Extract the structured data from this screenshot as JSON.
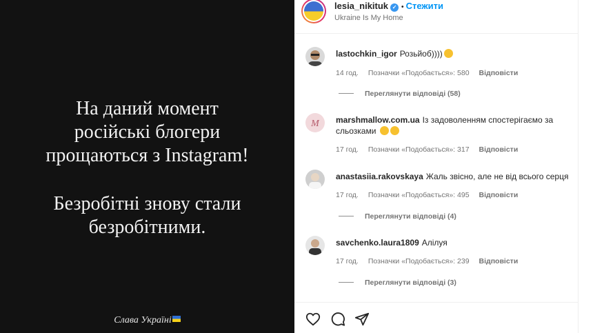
{
  "post": {
    "text_line_1": "На даний момент",
    "text_line_2": "російські блогери",
    "text_line_3": "прощаються з Instagram!",
    "text_line_4": "Безробітні знову стали",
    "text_line_5": "безробітними.",
    "footer": "Слава Україні"
  },
  "header": {
    "username": "lesia_nikituk",
    "follow_label": "Стежити",
    "subtitle": "Ukraine Is My Home"
  },
  "comments": [
    {
      "username": "lastochkin_igor",
      "text": "Розьйоб))))",
      "time": "14 год.",
      "likes": "Позначки «Подобається»: 580",
      "reply": "Відповісти",
      "view_replies": "Переглянути відповіді (58)"
    },
    {
      "username": "marshmallow.com.ua",
      "text": "Із задоволенням спостерігаємо за сльозками",
      "time": "17 год.",
      "likes": "Позначки «Подобається»: 317",
      "reply": "Відповісти"
    },
    {
      "username": "anastasiia.rakovskaya",
      "text": "Жаль звісно, але не від всього серця",
      "time": "17 год.",
      "likes": "Позначки «Подобається»: 495",
      "reply": "Відповісти",
      "view_replies": "Переглянути відповіді (4)"
    },
    {
      "username": "savchenko.laura1809",
      "text": "Алілуя",
      "time": "17 год.",
      "likes": "Позначки «Подобається»: 239",
      "reply": "Відповісти",
      "view_replies": "Переглянути відповіді (3)"
    }
  ],
  "icons": [
    "heart-icon",
    "comment-icon",
    "share-icon",
    "verified-icon"
  ],
  "colors": {
    "follow": "#0095f6",
    "post_bg": "#121212",
    "verified": "#3897f0"
  }
}
